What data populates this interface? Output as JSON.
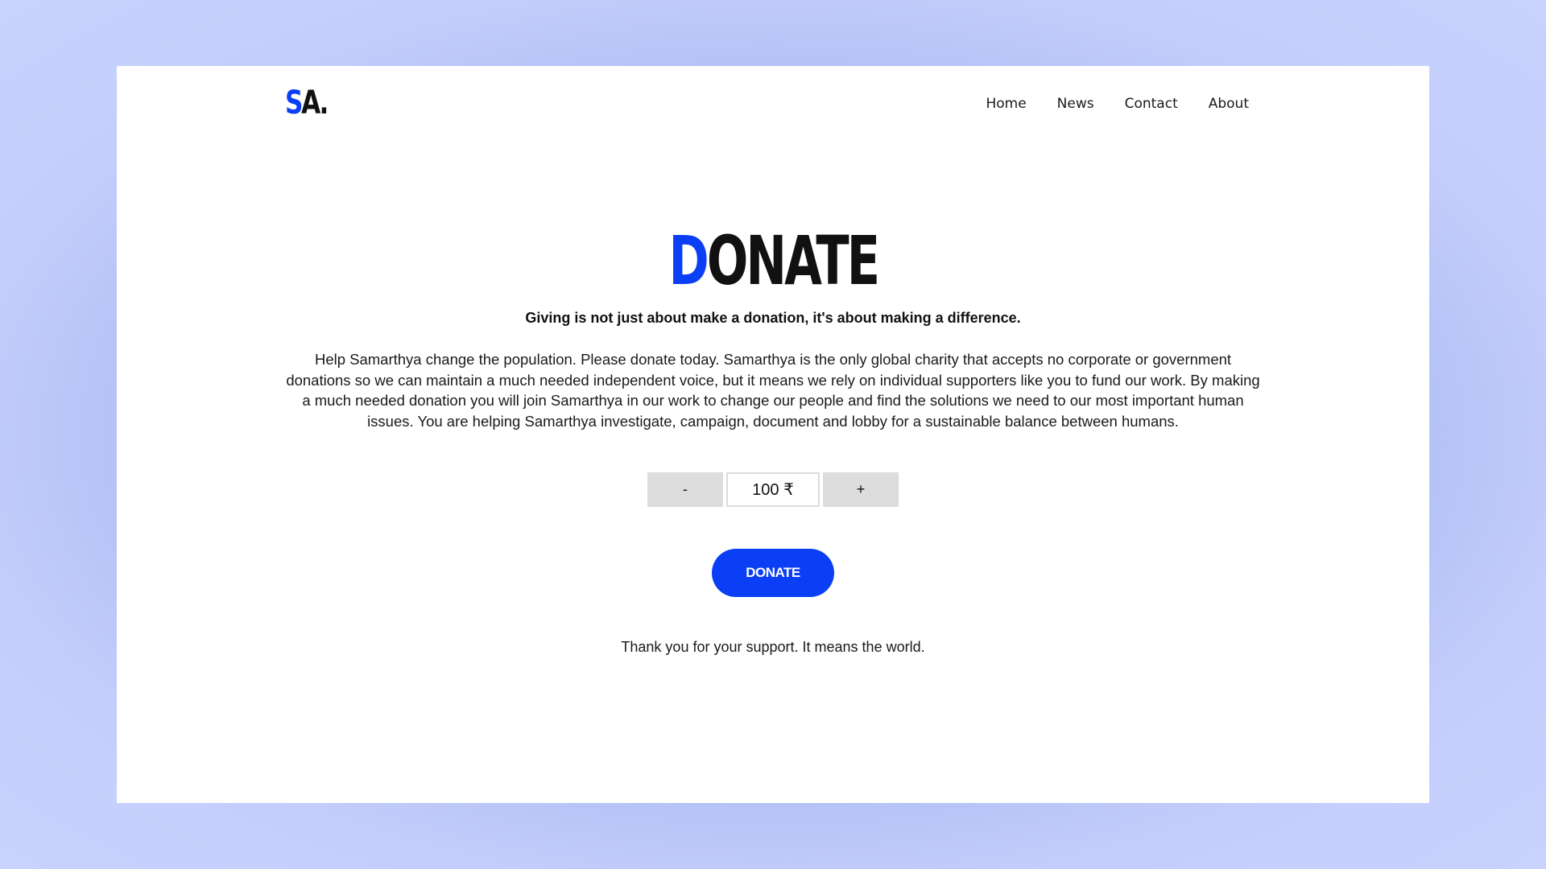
{
  "logo": {
    "first": "S",
    "rest": "A."
  },
  "nav": {
    "items": [
      {
        "label": "Home"
      },
      {
        "label": "News"
      },
      {
        "label": "Contact"
      },
      {
        "label": "About"
      }
    ]
  },
  "hero": {
    "title_first": "D",
    "title_rest": "ONATE",
    "tagline": "Giving is not just about make a donation, it's about making a difference.",
    "body": "Help Samarthya change the population. Please donate today. Samarthya is the only global charity that accepts no corporate or government donations so we can maintain a much needed independent voice, but it means we rely on individual supporters like you to fund our work. By making a much needed donation you will join Samarthya in our work to change our people and find the solutions we need to our most important human issues. You are helping Samarthya investigate, campaign, document and lobby for a sustainable balance between humans."
  },
  "stepper": {
    "decrement_label": "-",
    "increment_label": "+",
    "amount": "100 ₹"
  },
  "donate_button": {
    "label": "DONATE"
  },
  "thanks": "Thank you for your support. It means the world.",
  "colors": {
    "accent": "#0b3ff5",
    "text": "#111111",
    "button_gray": "#dcdcdc",
    "background_gradient_center": "#8e9ee8",
    "background_gradient_edge": "#c8d2fc"
  }
}
